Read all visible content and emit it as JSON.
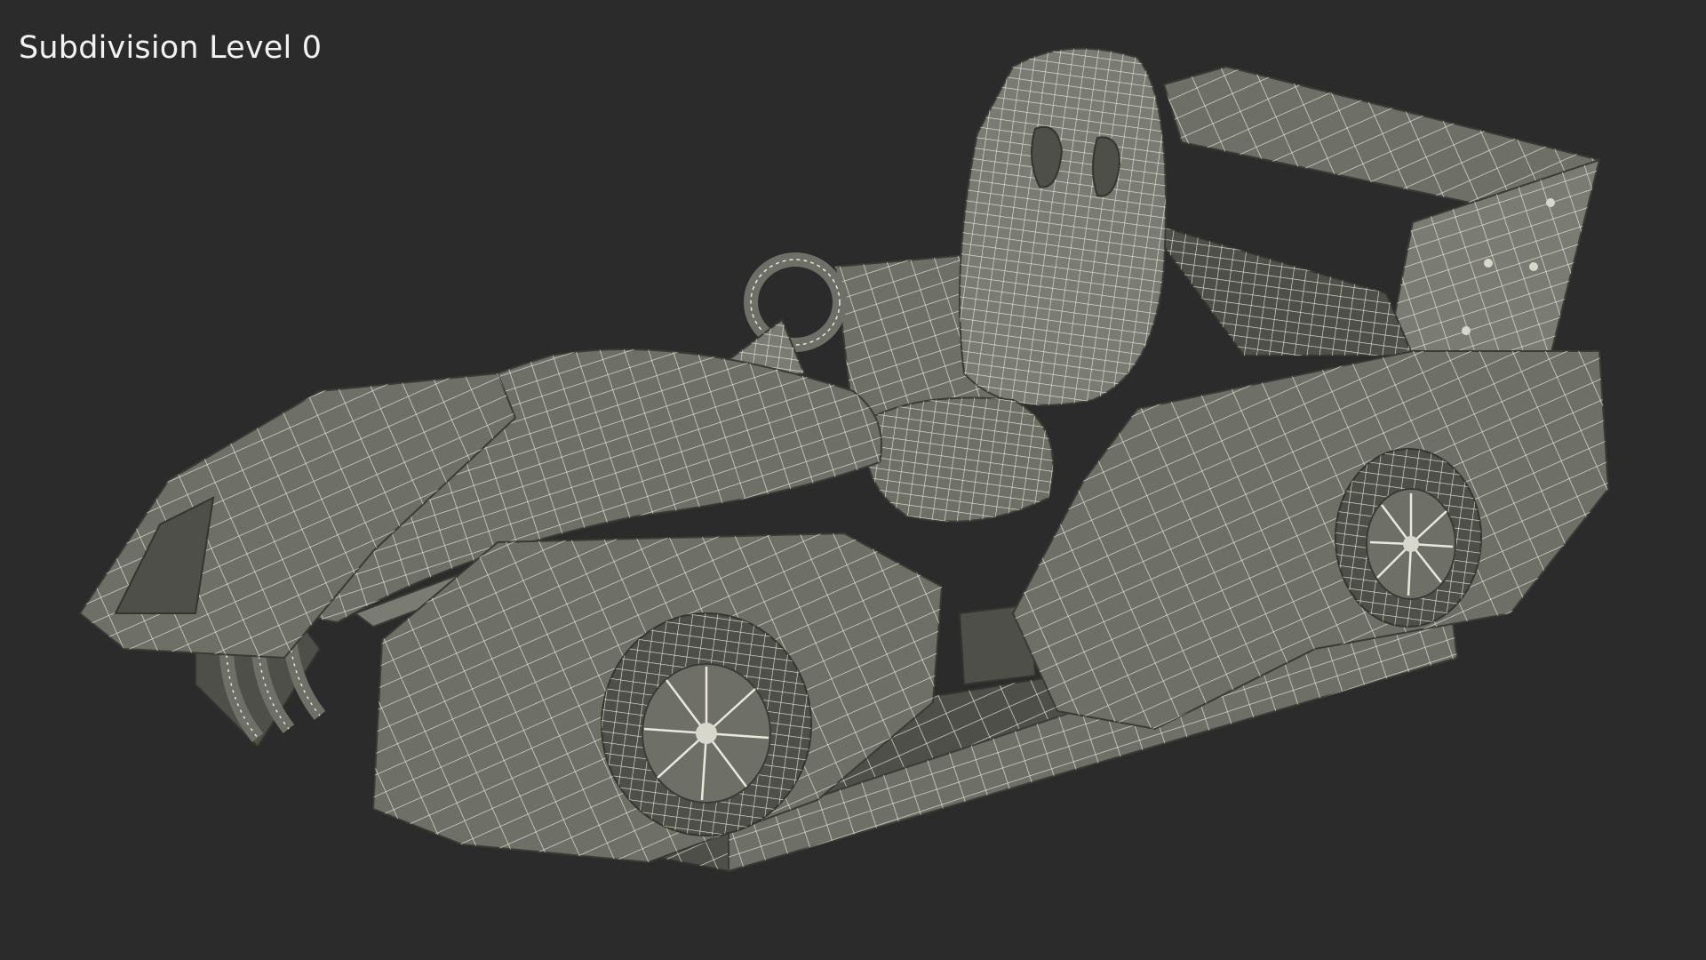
{
  "viewport": {
    "label": "Subdivision Level 0",
    "background_color": "#2b2b2b",
    "model_color": "#6e6f66",
    "wire_color": "#e9e8dc"
  }
}
